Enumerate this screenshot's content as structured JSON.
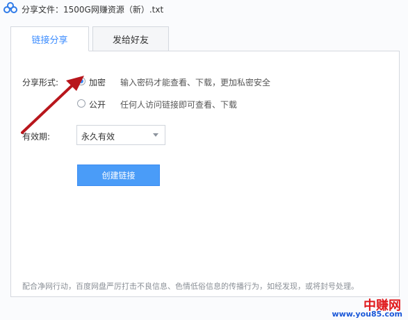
{
  "title": "分享文件：1500G网赚资源（新）.txt",
  "tabs": [
    {
      "label": "链接分享",
      "active": true
    },
    {
      "label": "发给好友",
      "active": false
    }
  ],
  "share_form": {
    "label": "分享形式:",
    "options": [
      {
        "label": "加密",
        "description": "输入密码才能查看、下载，更加私密安全",
        "checked": true
      },
      {
        "label": "公开",
        "description": "任何人访问链接即可查看、下载",
        "checked": false
      }
    ]
  },
  "validity": {
    "label": "有效期:",
    "value": "永久有效"
  },
  "create_button": "创建链接",
  "notice": "配合净网行动，百度网盘严厉打击不良信息、色情低俗信息的传播行为，如经发现，或将封号处理。",
  "watermark": {
    "brand": "中赚网",
    "site": "www.you85.com"
  },
  "colors": {
    "accent": "#3b8cff",
    "button": "#4a9cf8",
    "annotation_arrow": "#b8161c"
  },
  "icons": {
    "app": "baidu-netdisk-cloud-icon",
    "dropdown": "triangle-down-icon"
  }
}
